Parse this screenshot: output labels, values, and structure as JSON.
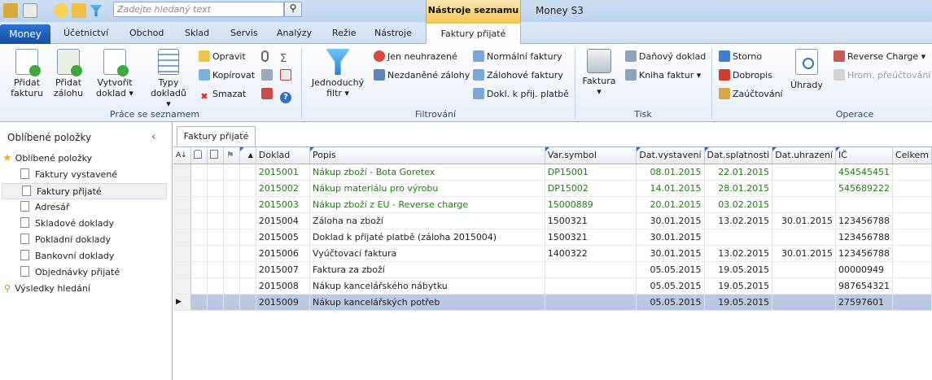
{
  "search": {
    "placeholder": "Zadejte hledaný text"
  },
  "contextual": {
    "header": "Nástroje seznamu",
    "tab": "Faktury přijaté"
  },
  "app_title": "Money S3",
  "tabs": {
    "money": "Money",
    "items": [
      "Účetnictví",
      "Obchod",
      "Sklad",
      "Servis",
      "Analýzy",
      "Režie",
      "Nástroje"
    ]
  },
  "ribbon": {
    "prace": {
      "label": "Práce se seznamem",
      "pridat_fakturu": [
        "Přidat",
        "fakturu"
      ],
      "pridat_zalohu": [
        "Přidat",
        "zálohu"
      ],
      "vytvorit_doklad": [
        "Vytvořit",
        "doklad ▾"
      ],
      "typy_dokladu": [
        "Typy",
        "dokladů ▾"
      ],
      "opravit": "Opravit",
      "kopirovat": "Kopírovat",
      "smazat": "Smazat"
    },
    "filtrovani": {
      "label": "Filtrování",
      "jednoduchy": [
        "Jednoduchý",
        "filtr ▾"
      ],
      "jen_neuhrazene": "Jen neuhrazené",
      "nezdanene": "Nezdaněné zálohy",
      "normalni": "Normální faktury",
      "zalohove": "Zálohové faktury",
      "dokl": "Dokl. k přij. platbě"
    },
    "tisk": {
      "label": "Tisk",
      "faktura": [
        "Faktura",
        "▾"
      ],
      "danovy": "Daňový doklad",
      "kniha": "Kniha faktur ▾"
    },
    "operace": {
      "label": "Operace",
      "storno": "Storno",
      "dobropis": "Dobropis",
      "zauctovani": "Zaúčtování",
      "uhrady": "Úhrady",
      "reverse": "Reverse Charge ▾",
      "hrom": "Hrom. přeúčtování"
    }
  },
  "sidebar": {
    "title": "Oblíbené položky",
    "collapse": "‹",
    "root": "Oblíbené položky",
    "items": [
      "Faktury vystavené",
      "Faktury přijaté",
      "Adresář",
      "Skladové doklady",
      "Pokladní doklady",
      "Bankovní doklady",
      "Objednávky přijaté"
    ],
    "search_results": "Výsledky hledání"
  },
  "content_tab": "Faktury přijaté",
  "table": {
    "columns": [
      "Doklad",
      "Popis",
      "Var.symbol",
      "Dat.vystavení",
      "Dat.splatnosti",
      "Dat.uhrazení",
      "IČ",
      "Celkem"
    ],
    "rows": [
      {
        "doklad": "2015001",
        "popis": "Nákup zboží - Bota Goretex",
        "vs": "DP15001",
        "vyst": "08.01.2015",
        "splat": "22.01.2015",
        "uhr": "",
        "ic": "454545451",
        "green": true
      },
      {
        "doklad": "2015002",
        "popis": "Nákup materiálu pro výrobu",
        "vs": "DP15002",
        "vyst": "14.01.2015",
        "splat": "28.01.2015",
        "uhr": "",
        "ic": "545689222",
        "green": true
      },
      {
        "doklad": "2015003",
        "popis": "Nákup zboží z EU - Reverse charge",
        "vs": "15000889",
        "vyst": "20.01.2015",
        "splat": "03.02.2015",
        "uhr": "",
        "ic": "",
        "green": true
      },
      {
        "doklad": "2015004",
        "popis": "Záloha na zboží",
        "vs": "1500321",
        "vyst": "30.01.2015",
        "splat": "13.02.2015",
        "uhr": "30.01.2015",
        "ic": "123456788",
        "green": false
      },
      {
        "doklad": "2015005",
        "popis": "Doklad k přijaté platbě (záloha 2015004)",
        "vs": "1500321",
        "vyst": "30.01.2015",
        "splat": "",
        "uhr": "",
        "ic": "123456788",
        "green": false
      },
      {
        "doklad": "2015006",
        "popis": "Vyúčtovací faktura",
        "vs": "1400322",
        "vyst": "30.01.2015",
        "splat": "13.02.2015",
        "uhr": "30.01.2015",
        "ic": "123456788",
        "green": false
      },
      {
        "doklad": "2015007",
        "popis": "Faktura za zboží",
        "vs": "",
        "vyst": "05.05.2015",
        "splat": "19.05.2015",
        "uhr": "",
        "ic": "00000949",
        "green": false
      },
      {
        "doklad": "2015008",
        "popis": "Nákup kancelářského nábytku",
        "vs": "",
        "vyst": "05.05.2015",
        "splat": "19.05.2015",
        "uhr": "",
        "ic": "987654321",
        "green": false
      },
      {
        "doklad": "2015009",
        "popis": "Nákup kancelářských potřeb",
        "vs": "",
        "vyst": "05.05.2015",
        "splat": "19.05.2015",
        "uhr": "",
        "ic": "27597601",
        "green": false,
        "selected": true
      }
    ]
  }
}
